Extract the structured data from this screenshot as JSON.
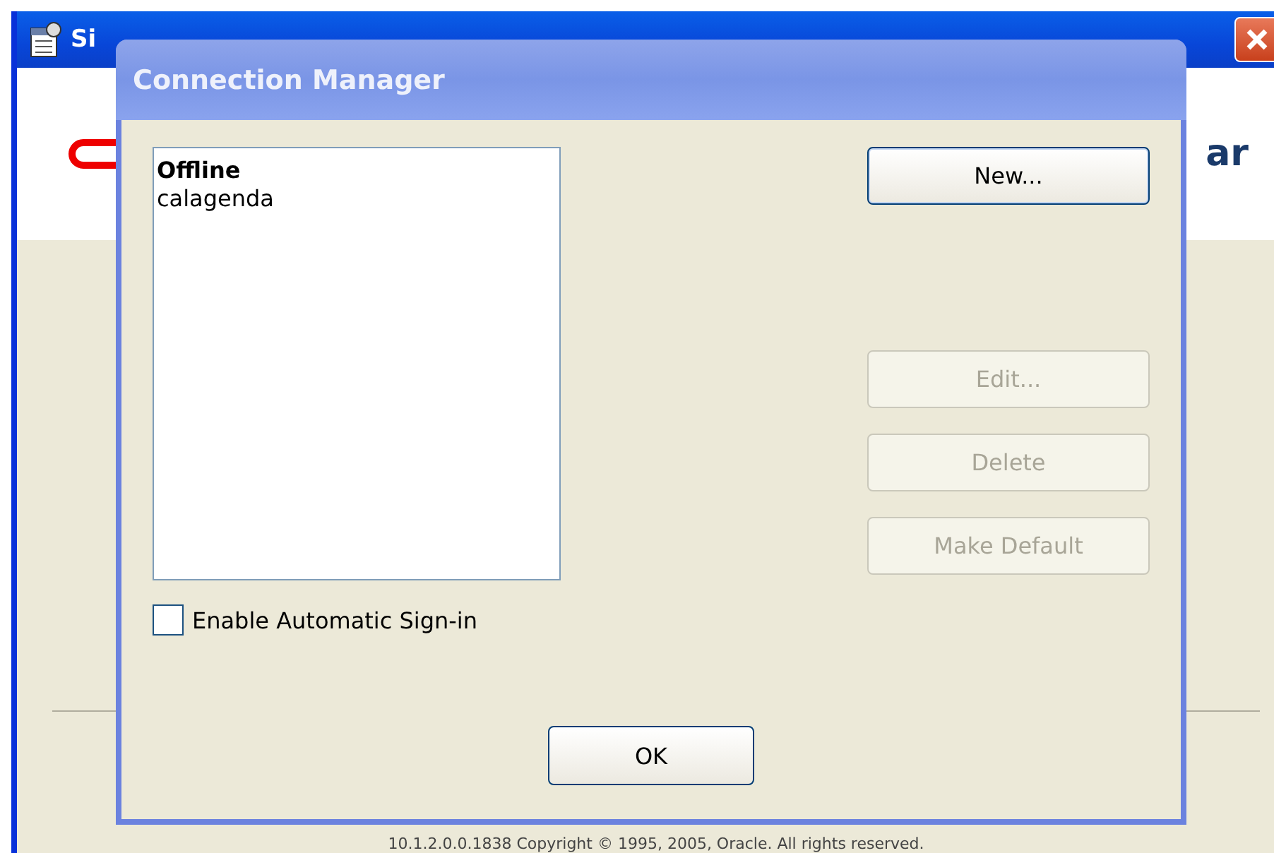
{
  "background_window": {
    "title": "Si",
    "banner_text": "ar",
    "copyright": "10.1.2.0.0.1838 Copyright © 1995, 2005, Oracle. All rights reserved."
  },
  "dialog": {
    "title": "Connection Manager",
    "connections": [
      {
        "name": "Offline",
        "default": true
      },
      {
        "name": "calagenda",
        "default": false
      }
    ],
    "buttons": [
      {
        "label": "New...",
        "disabled": false
      },
      {
        "label": "Edit...",
        "disabled": true
      },
      {
        "label": "Delete",
        "disabled": true
      },
      {
        "label": "Make Default",
        "disabled": true
      }
    ],
    "auto_signin": {
      "label": "Enable Automatic Sign-in",
      "checked": false
    },
    "ok_button": "OK"
  }
}
